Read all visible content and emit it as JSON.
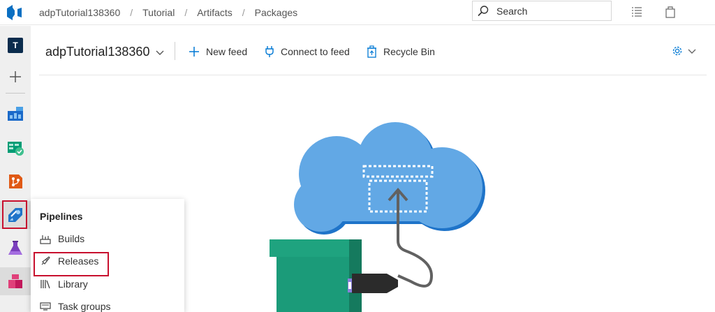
{
  "breadcrumb": {
    "org": "adpTutorial138360",
    "project": "Tutorial",
    "hub": "Artifacts",
    "page": "Packages"
  },
  "search": {
    "placeholder": "Search"
  },
  "rail": {
    "avatar_letter": "T"
  },
  "header": {
    "feed_name": "adpTutorial138360",
    "new_feed": "New feed",
    "connect": "Connect to feed",
    "recycle": "Recycle Bin"
  },
  "flyout": {
    "title": "Pipelines",
    "items": [
      "Builds",
      "Releases",
      "Library",
      "Task groups"
    ]
  },
  "colors": {
    "accent": "#0078d4",
    "highlight": "#c8102e",
    "cloud": "#62a8e5",
    "box": "#1fa37f"
  }
}
